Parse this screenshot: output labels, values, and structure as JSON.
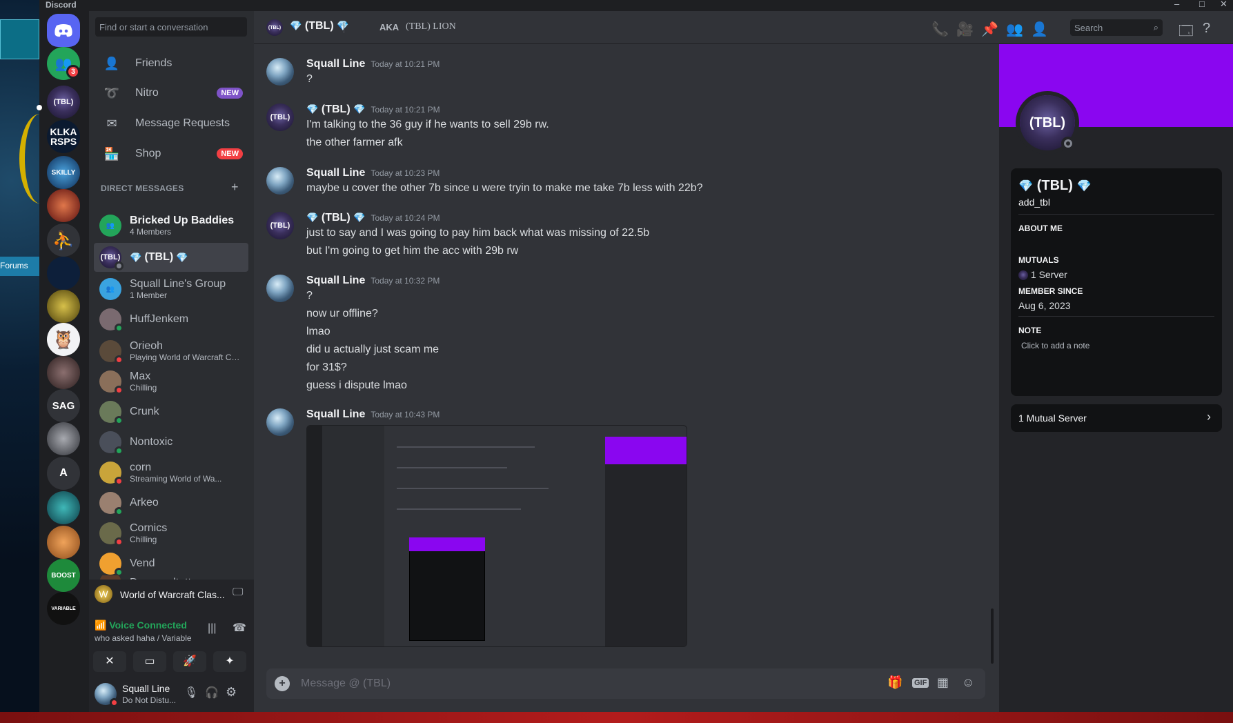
{
  "app_title": "Discord",
  "sidebar": {
    "search_placeholder": "Find or start a conversation",
    "nav": [
      {
        "label": "Friends",
        "icon": "friends-icon"
      },
      {
        "label": "Nitro",
        "icon": "nitro-icon",
        "badge": "NEW"
      },
      {
        "label": "Message Requests",
        "icon": "envelope-icon"
      },
      {
        "label": "Shop",
        "icon": "shop-icon",
        "badge": "NEW"
      }
    ],
    "dm_header": "DIRECT MESSAGES",
    "dms": [
      {
        "name": "Bricked Up Baddies",
        "sub": "4 Members"
      },
      {
        "name": "(TBL)",
        "sub": ""
      },
      {
        "name": "Squall Line's Group",
        "sub": "1 Member"
      },
      {
        "name": "HuffJenkem",
        "sub": ""
      },
      {
        "name": "Orieoh",
        "sub": "Playing World of Warcraft Cla..."
      },
      {
        "name": "Max",
        "sub": "Chilling"
      },
      {
        "name": "Crunk",
        "sub": ""
      },
      {
        "name": "Nontoxic",
        "sub": ""
      },
      {
        "name": "corn",
        "sub": "Streaming World of Wa..."
      },
      {
        "name": "Arkeo",
        "sub": ""
      },
      {
        "name": "Cornics",
        "sub": "Chilling"
      },
      {
        "name": "Vend",
        "sub": ""
      },
      {
        "name": "Depossultattoo",
        "sub": ""
      }
    ]
  },
  "guilds": {
    "friends_badge": "3",
    "labels": [
      "(TBL)",
      "KLKA RSPS",
      "SKILLY",
      "SAG",
      "A",
      "BOOST",
      "VARIABLE"
    ]
  },
  "desktop": {
    "forums_label": "Forums"
  },
  "activity": {
    "game": "World of Warcraft Clas..."
  },
  "voice": {
    "status": "Voice Connected",
    "channel": "who asked haha / Variable"
  },
  "user": {
    "name": "Squall Line",
    "status": "Do Not Distu..."
  },
  "header": {
    "dm_name": "(TBL)",
    "aka_label": "AKA",
    "aka_name": "(TBL) LION",
    "search_placeholder": "Search"
  },
  "messages": [
    {
      "author": "Squall Line",
      "time": "Today at 10:21 PM",
      "lines": [
        "?"
      ]
    },
    {
      "author": "(TBL)",
      "time": "Today at 10:21 PM",
      "lines": [
        "I'm talking to the 36 guy if he wants to sell 29b rw.",
        "the other farmer  afk"
      ]
    },
    {
      "author": "Squall Line",
      "time": "Today at 10:23 PM",
      "lines": [
        "maybe u cover the other 7b since u were tryin to make me take 7b less with 22b?"
      ]
    },
    {
      "author": "(TBL)",
      "time": "Today at 10:24 PM",
      "lines": [
        "just to say and I was going to pay him back what was missing of 22.5b",
        "but I'm going to get him the acc with 29b rw"
      ]
    },
    {
      "author": "Squall Line",
      "time": "Today at 10:32 PM",
      "lines": [
        "?",
        "now ur offline?",
        "lmao",
        "did u actually just scam me",
        "for 31$?",
        "guess i dispute lmao"
      ]
    },
    {
      "author": "Squall Line",
      "time": "Today at 10:43 PM",
      "lines": []
    }
  ],
  "composer": {
    "placeholder": "Message @ (TBL)"
  },
  "profile": {
    "display_name": "(TBL)",
    "username": "add_tbl",
    "avatar_text": "(TBL)",
    "about_label": "ABOUT ME",
    "mutuals_label": "MUTUALS",
    "mutuals_value": "1 Server",
    "member_since_label": "MEMBER SINCE",
    "member_since": "Aug 6, 2023",
    "note_label": "NOTE",
    "note_placeholder": "Click to add a note",
    "mutual_server": "1 Mutual Server",
    "banner_color": "#8a06f0"
  }
}
